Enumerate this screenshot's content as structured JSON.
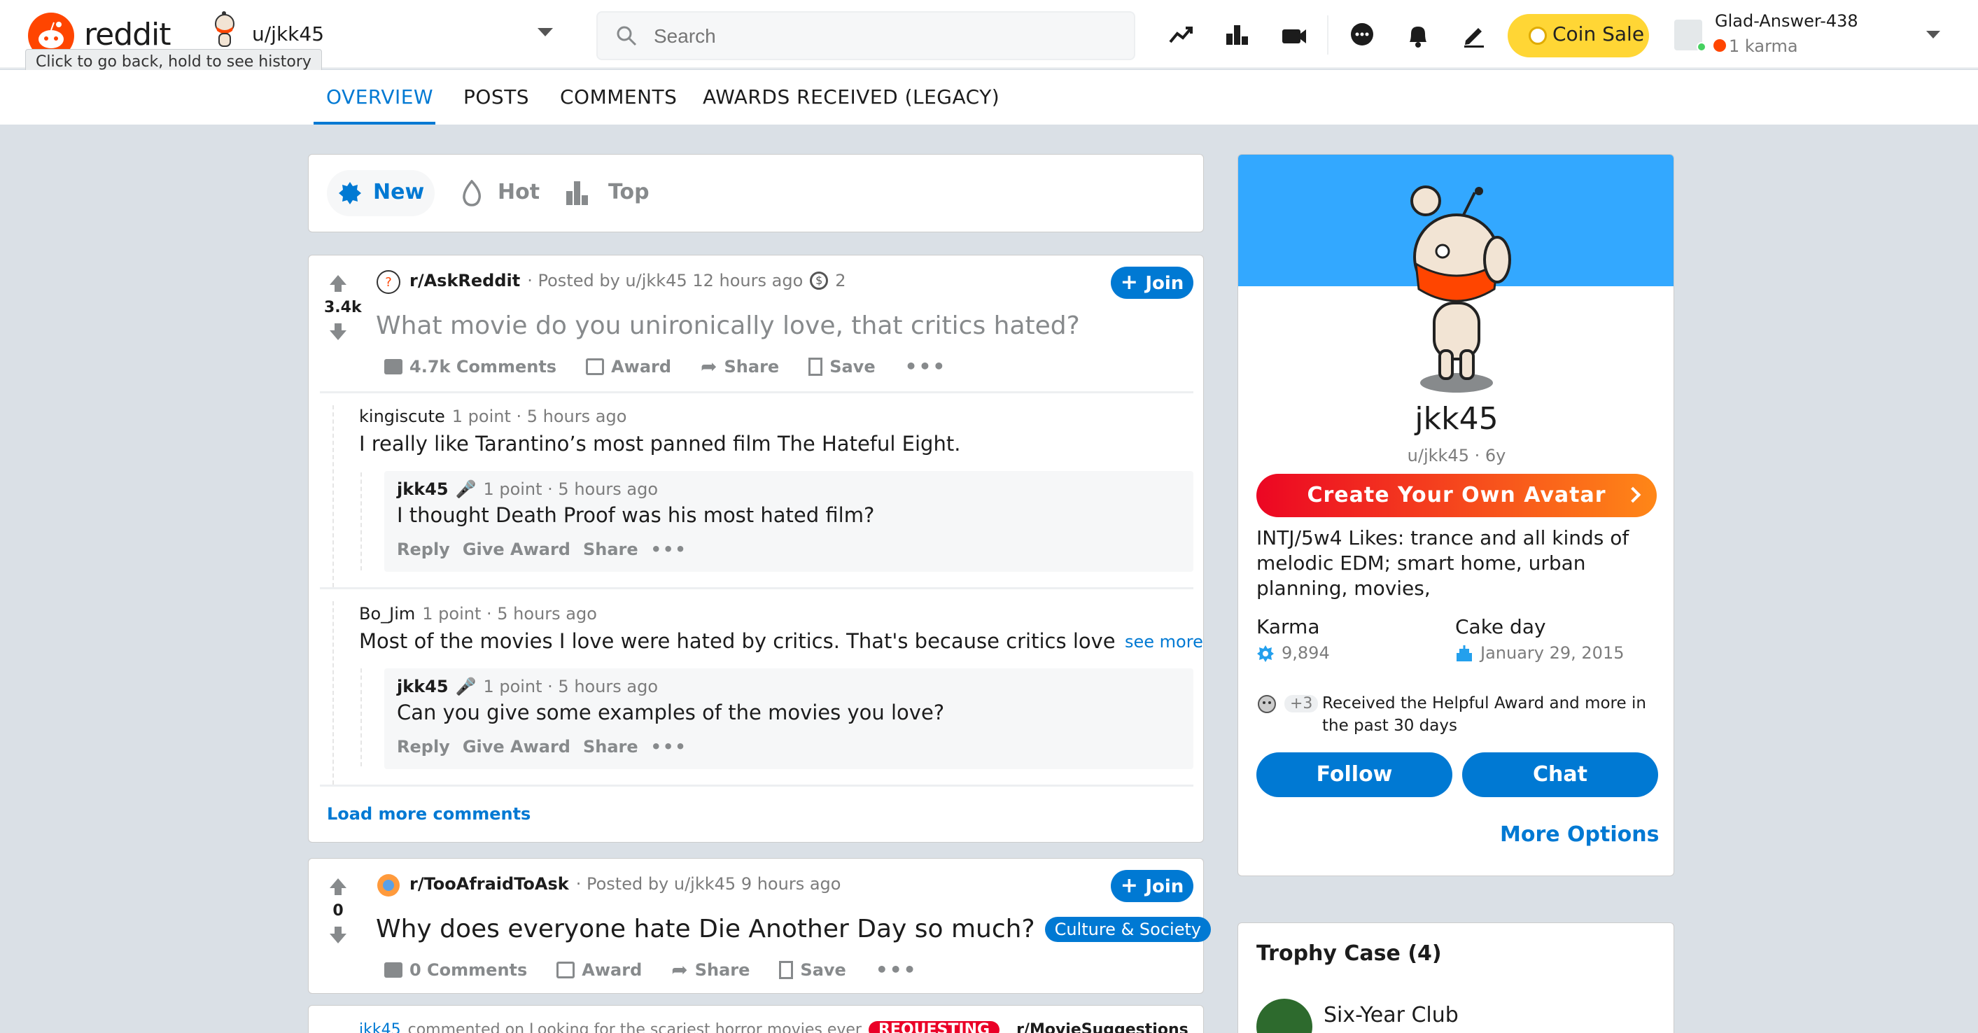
{
  "header": {
    "logo_text": "reddit",
    "tooltip": "Click to go back, hold to see history",
    "context_label": "u/jkk45",
    "search_placeholder": "Search",
    "coin_sale_label": "Coin Sale",
    "user": {
      "name": "Glad-Answer-438",
      "karma": "1 karma"
    }
  },
  "tabs": [
    {
      "label": "OVERVIEW",
      "active": true
    },
    {
      "label": "POSTS"
    },
    {
      "label": "COMMENTS"
    },
    {
      "label": "AWARDS RECEIVED (LEGACY)"
    }
  ],
  "sort": {
    "new": "New",
    "hot": "Hot",
    "top": "Top"
  },
  "post1": {
    "votes": "3.4k",
    "subreddit": "r/AskReddit",
    "posted_by": "· Posted by u/jkk45 12 hours ago",
    "award_count": "2",
    "join_label": "Join",
    "title": "What movie do you unironically love, that critics hated?",
    "actions": {
      "comments": "4.7k Comments",
      "award": "Award",
      "share": "Share",
      "save": "Save"
    },
    "comments": [
      {
        "author": "kingiscute",
        "meta": "1 point · 5 hours ago",
        "body": "I really like Tarantino’s most panned film The Hateful Eight.",
        "reply": {
          "author": "jkk45",
          "meta": "1 point · 5 hours ago",
          "body": "I thought Death Proof was his most hated film?"
        }
      },
      {
        "author": "Bo_Jim",
        "meta": "1 point · 5 hours ago",
        "body": "Most of the movies I love were hated by critics. That's because critics love movies t",
        "see_more": "see more",
        "reply": {
          "author": "jkk45",
          "meta": "1 point · 5 hours ago",
          "body": "Can you give some examples of the movies you love?"
        }
      }
    ],
    "comment_actions": {
      "reply": "Reply",
      "give_award": "Give Award",
      "share": "Share"
    },
    "load_more": "Load more comments"
  },
  "post2": {
    "votes": "0",
    "subreddit": "r/TooAfraidToAsk",
    "posted_by": "· Posted by u/jkk45 9 hours ago",
    "join_label": "Join",
    "title": "Why does everyone hate Die Another Day so much?",
    "flair": "Culture & Society",
    "actions": {
      "comments": "0 Comments",
      "award": "Award",
      "share": "Share",
      "save": "Save"
    }
  },
  "post3": {
    "author": "jkk45",
    "text": "commented on Looking for the scariest horror movies ever",
    "flair": "REQUESTING",
    "subreddit": "r/MovieSuggestions"
  },
  "profile": {
    "name": "jkk45",
    "handle": "u/jkk45 · 6y",
    "create_avatar": "Create Your Own Avatar",
    "bio": "INTJ/5w4 Likes: trance and all kinds of melodic EDM; smart home, urban planning, movies,",
    "karma_label": "Karma",
    "karma_value": "9,894",
    "cakeday_label": "Cake day",
    "cakeday_value": "January 29, 2015",
    "award_plus": "+3",
    "award_note": "Received the Helpful Award and more in the past 30 days",
    "follow": "Follow",
    "chat": "Chat",
    "more_options": "More Options"
  },
  "trophy": {
    "title": "Trophy Case (4)",
    "first": "Six-Year Club"
  },
  "colors": {
    "brand": "#ff4500",
    "accent": "#0079d3",
    "coin": "#ffd635",
    "banner": "#33a8ff"
  }
}
